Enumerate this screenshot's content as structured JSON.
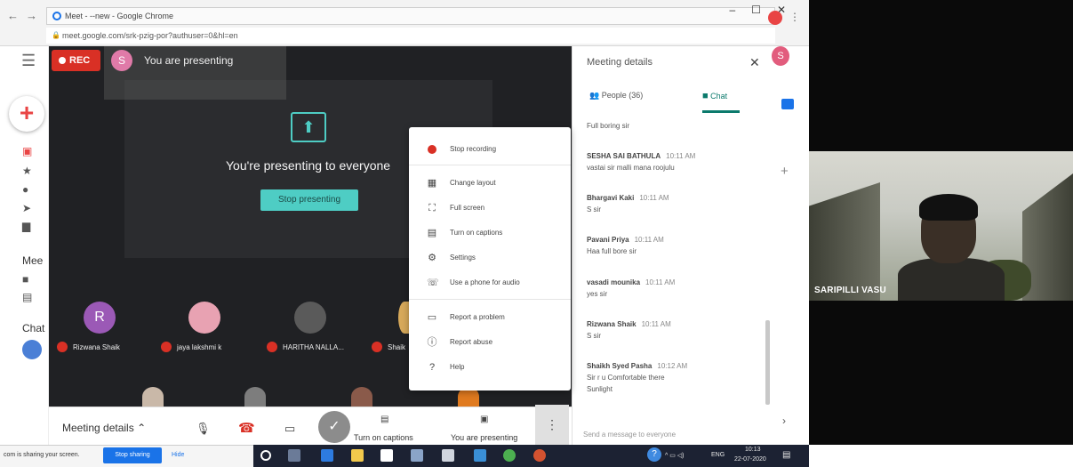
{
  "window": {
    "title": "Meet - --new - Google Chrome",
    "url": "meet.google.com/srk-pzig-por?authuser=0&hl=en",
    "controls": [
      "–",
      "☐",
      "✕"
    ]
  },
  "sidebar": {
    "section_meet": "Mee",
    "section_chat": "Chat"
  },
  "meet": {
    "rec_label": "REC",
    "presenter_initial": "S",
    "presenting_banner": "You are presenting",
    "presenting_to_everyone": "You're presenting to everyone",
    "stop_presenting": "Stop presenting",
    "participants": [
      {
        "initial": "R",
        "name": "Rizwana Shaik",
        "color": "#9b59b6"
      },
      {
        "initial": "",
        "name": "jaya lakshmi k",
        "color": "#e8a2b2"
      },
      {
        "initial": "",
        "name": "HARITHA NALLA...",
        "color": "#5a5a5a"
      },
      {
        "initial": "",
        "name": "Shaik",
        "color": "#d7a95a"
      }
    ]
  },
  "controls": {
    "meeting_details": "Meeting details",
    "captions_label": "Turn on captions",
    "presenting_label": "You are presenting"
  },
  "menu": {
    "items": [
      {
        "icon": "record",
        "label": "Stop recording"
      },
      {
        "icon": "layout",
        "label": "Change layout"
      },
      {
        "icon": "fullscreen",
        "label": "Full screen"
      },
      {
        "icon": "captions",
        "label": "Turn on captions"
      },
      {
        "icon": "settings",
        "label": "Settings"
      },
      {
        "icon": "phone",
        "label": "Use a phone for audio"
      },
      {
        "icon": "report",
        "label": "Report a problem"
      },
      {
        "icon": "abuse",
        "label": "Report abuse"
      },
      {
        "icon": "help",
        "label": "Help"
      }
    ]
  },
  "chat": {
    "panel_title": "Meeting details",
    "people_tab": "People (36)",
    "chat_tab": "Chat",
    "first_text": "Full boring sir",
    "messages": [
      {
        "name": "SESHA SAI BATHULA",
        "time": "10:11 AM",
        "lines": [
          "vastai sir malli mana roojulu"
        ]
      },
      {
        "name": "Bhargavi Kaki",
        "time": "10:11 AM",
        "lines": [
          "S sir"
        ]
      },
      {
        "name": "Pavani Priya",
        "time": "10:11 AM",
        "lines": [
          "Haa full bore sir"
        ]
      },
      {
        "name": "vasadi mounika",
        "time": "10:11 AM",
        "lines": [
          "yes sir"
        ]
      },
      {
        "name": "Rizwana Shaik",
        "time": "10:11 AM",
        "lines": [
          "S sir"
        ]
      },
      {
        "name": "Shaikh Syed Pasha",
        "time": "10:12 AM",
        "lines": [
          "Sir r u Comfortable there",
          "Sunlight"
        ]
      }
    ],
    "input_placeholder": "Send a message to everyone"
  },
  "chrome_right": {
    "avatar_initial": "S"
  },
  "camera": {
    "name": "SARIPILLI VASU"
  },
  "share_bar": {
    "text": "com is sharing your screen.",
    "stop_sharing": "Stop sharing",
    "hide": "Hide"
  },
  "taskbar": {
    "lang": "ENG",
    "time": "10:13",
    "date": "22-07-2020",
    "tray_icons": "^ ▭ ◁) "
  },
  "colors": {
    "meet_bg": "#202124",
    "accent_teal": "#4ecdc4",
    "rec_red": "#d93025",
    "chat_green": "#0b7a6c",
    "taskbar": "#1c2233"
  }
}
